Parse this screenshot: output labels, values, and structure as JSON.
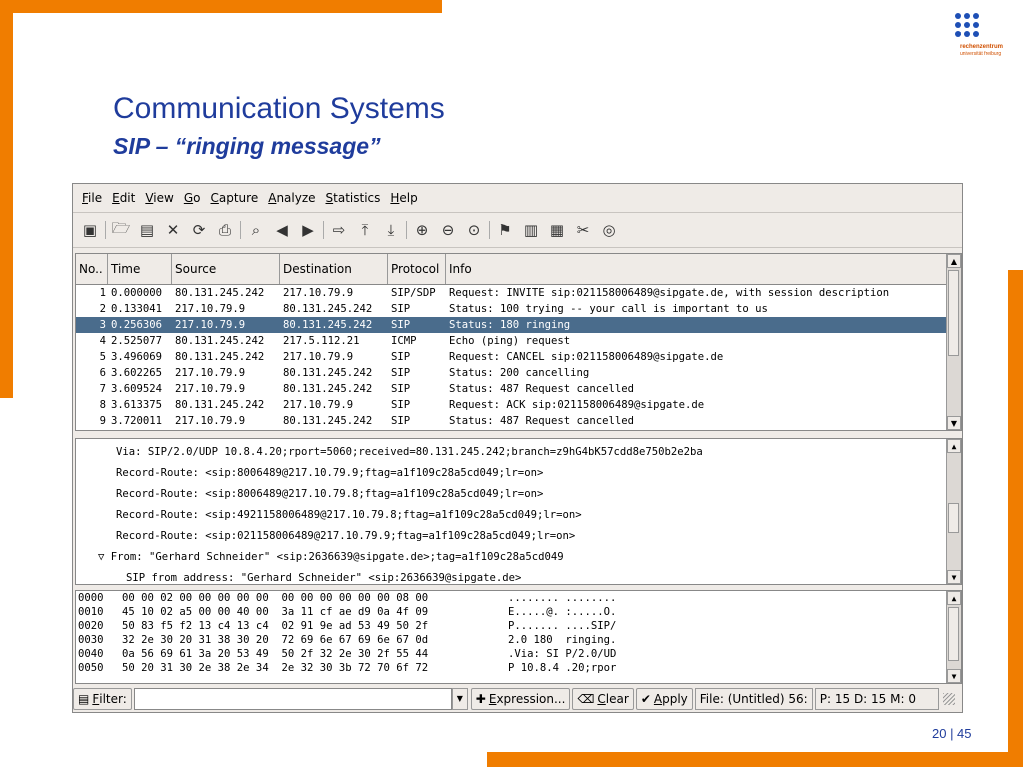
{
  "slide": {
    "title": "Communication Systems",
    "subtitle": "SIP – “ringing message”",
    "page": "20 | 45",
    "logo_mark": "rz",
    "logo_line1": "rechenzentrum",
    "logo_line2": "universität freiburg"
  },
  "colors": {
    "accent_orange": "#f07d00",
    "title_blue": "#1f3c9c",
    "selection": "#4a6c8c"
  },
  "menu": [
    {
      "key": "F",
      "rest": "ile"
    },
    {
      "key": "E",
      "rest": "dit"
    },
    {
      "key": "V",
      "rest": "iew"
    },
    {
      "key": "G",
      "rest": "o"
    },
    {
      "key": "C",
      "rest": "apture"
    },
    {
      "key": "A",
      "rest": "nalyze"
    },
    {
      "key": "S",
      "rest": "tatistics"
    },
    {
      "key": "H",
      "rest": "elp"
    }
  ],
  "toolbar_icons": [
    "interfaces-icon",
    "open-file-icon",
    "save-icon",
    "close-icon",
    "reload-icon",
    "print-icon",
    "find-icon",
    "go-back-icon",
    "go-forward-icon",
    "go-to-packet-icon",
    "go-first-icon",
    "go-last-icon",
    "zoom-in-icon",
    "zoom-out-icon",
    "zoom-normal-icon",
    "capture-filter-icon",
    "display-filter-icon",
    "coloring-rules-icon",
    "preferences-icon",
    "help-icon"
  ],
  "packet_list": {
    "columns": [
      "No..",
      "Time",
      "Source",
      "Destination",
      "Protocol",
      "Info"
    ],
    "rows": [
      {
        "no": "1",
        "time": "0.000000",
        "source": "80.131.245.242",
        "destination": "217.10.79.9",
        "protocol": "SIP/SDP",
        "info": "Request: INVITE sip:021158006489@sipgate.de, with session description"
      },
      {
        "no": "2",
        "time": "0.133041",
        "source": "217.10.79.9",
        "destination": "80.131.245.242",
        "protocol": "SIP",
        "info": "Status: 100 trying -- your call is important to us"
      },
      {
        "no": "3",
        "time": "0.256306",
        "source": "217.10.79.9",
        "destination": "80.131.245.242",
        "protocol": "SIP",
        "info": "Status: 180 ringing"
      },
      {
        "no": "4",
        "time": "2.525077",
        "source": "80.131.245.242",
        "destination": "217.5.112.21",
        "protocol": "ICMP",
        "info": "Echo (ping) request"
      },
      {
        "no": "5",
        "time": "3.496069",
        "source": "80.131.245.242",
        "destination": "217.10.79.9",
        "protocol": "SIP",
        "info": "Request: CANCEL sip:021158006489@sipgate.de"
      },
      {
        "no": "6",
        "time": "3.602265",
        "source": "217.10.79.9",
        "destination": "80.131.245.242",
        "protocol": "SIP",
        "info": "Status: 200 cancelling"
      },
      {
        "no": "7",
        "time": "3.609524",
        "source": "217.10.79.9",
        "destination": "80.131.245.242",
        "protocol": "SIP",
        "info": "Status: 487 Request cancelled"
      },
      {
        "no": "8",
        "time": "3.613375",
        "source": "80.131.245.242",
        "destination": "217.10.79.9",
        "protocol": "SIP",
        "info": "Request: ACK sip:021158006489@sipgate.de"
      },
      {
        "no": "9",
        "time": "3.720011",
        "source": "217.10.79.9",
        "destination": "80.131.245.242",
        "protocol": "SIP",
        "info": "Status: 487 Request cancelled"
      }
    ],
    "selected_index": 2
  },
  "details": [
    "Via: SIP/2.0/UDP 10.8.4.20;rport=5060;received=80.131.245.242;branch=z9hG4bK57cdd8e750b2e2ba",
    "Record-Route: <sip:8006489@217.10.79.9;ftag=a1f109c28a5cd049;lr=on>",
    "Record-Route: <sip:8006489@217.10.79.8;ftag=a1f109c28a5cd049;lr=on>",
    "Record-Route: <sip:4921158006489@217.10.79.8;ftag=a1f109c28a5cd049;lr=on>",
    "Record-Route: <sip:021158006489@217.10.79.9;ftag=a1f109c28a5cd049;lr=on>",
    "▽ From: \"Gerhard Schneider\" <sip:2636639@sipgate.de>;tag=a1f109c28a5cd049",
    "SIP from address: \"Gerhard Schneider\" <sip:2636639@sipgate.de>"
  ],
  "hex": [
    {
      "offset": "0000",
      "bytes": "00 00 02 00 00 00 00 00  00 00 00 00 00 00 08 00",
      "ascii": "........ ........"
    },
    {
      "offset": "0010",
      "bytes": "45 10 02 a5 00 00 40 00  3a 11 cf ae d9 0a 4f 09",
      "ascii": "E.....@. :.....O."
    },
    {
      "offset": "0020",
      "bytes": "50 83 f5 f2 13 c4 13 c4  02 91 9e ad 53 49 50 2f",
      "ascii": "P....... ....SIP/"
    },
    {
      "offset": "0030",
      "bytes": "32 2e 30 20 31 38 30 20  72 69 6e 67 69 6e 67 0d",
      "ascii": "2.0 180  ringing."
    },
    {
      "offset": "0040",
      "bytes": "0a 56 69 61 3a 20 53 49  50 2f 32 2e 30 2f 55 44",
      "ascii": ".Via: SI P/2.0/UD"
    },
    {
      "offset": "0050",
      "bytes": "50 20 31 30 2e 38 2e 34  2e 32 30 3b 72 70 6f 72",
      "ascii": "P 10.8.4 .20;rpor"
    }
  ],
  "filterbar": {
    "filter_key": "F",
    "filter_rest": "ilter:",
    "filter_value": "",
    "expression_key": "E",
    "expression_rest": "xpression...",
    "clear_key": "C",
    "clear_rest": "lear",
    "apply_key": "A",
    "apply_rest": "pply",
    "file_status": "File: (Untitled) 56:",
    "packet_status": "P: 15 D: 15 M: 0"
  }
}
